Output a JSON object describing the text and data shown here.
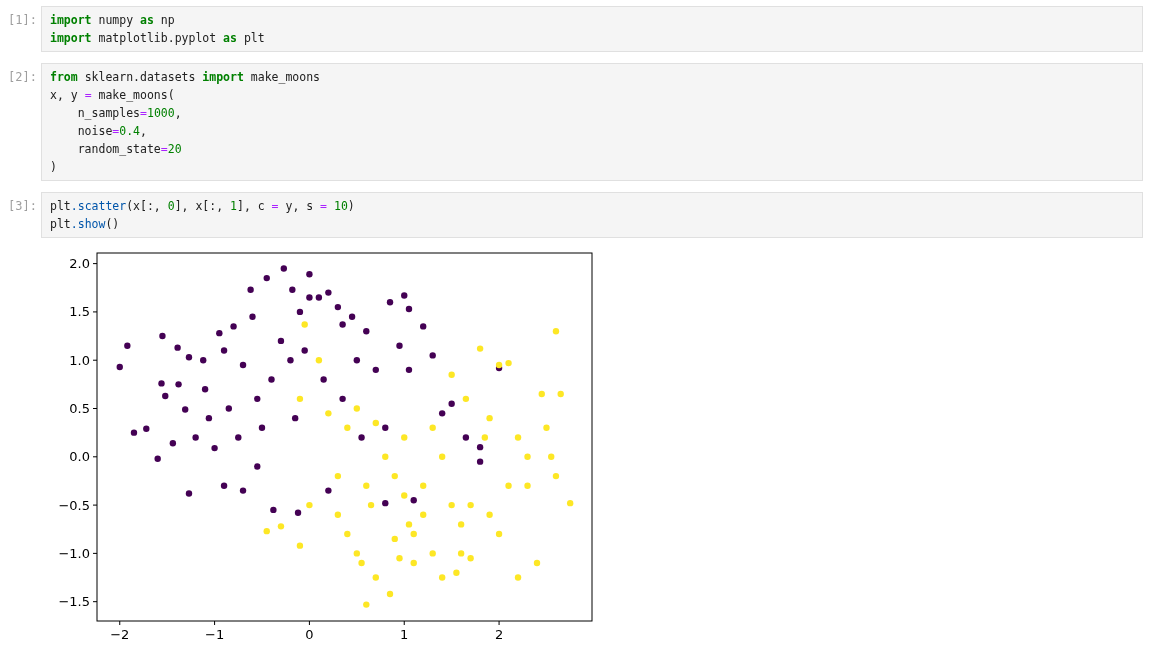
{
  "cells": [
    {
      "prompt": "[1]:",
      "lines": [
        [
          {
            "text": "import",
            "kind": "kw"
          },
          {
            "text": " numpy ",
            "kind": "plain"
          },
          {
            "text": "as",
            "kind": "kw"
          },
          {
            "text": " np",
            "kind": "plain"
          }
        ],
        [
          {
            "text": "import",
            "kind": "kw"
          },
          {
            "text": " matplotlib.pyplot ",
            "kind": "plain"
          },
          {
            "text": "as",
            "kind": "kw"
          },
          {
            "text": " plt",
            "kind": "plain"
          }
        ]
      ]
    },
    {
      "prompt": "[2]:",
      "lines": [
        [
          {
            "text": "from",
            "kind": "kw"
          },
          {
            "text": " sklearn.datasets ",
            "kind": "plain"
          },
          {
            "text": "import",
            "kind": "kw"
          },
          {
            "text": " make_moons",
            "kind": "plain"
          }
        ],
        [
          {
            "text": "x, y ",
            "kind": "plain"
          },
          {
            "text": "=",
            "kind": "op"
          },
          {
            "text": " make_moons(",
            "kind": "plain"
          }
        ],
        [
          {
            "text": "    n_samples",
            "kind": "plain"
          },
          {
            "text": "=",
            "kind": "op"
          },
          {
            "text": "1000",
            "kind": "num"
          },
          {
            "text": ",",
            "kind": "plain"
          }
        ],
        [
          {
            "text": "    noise",
            "kind": "plain"
          },
          {
            "text": "=",
            "kind": "op"
          },
          {
            "text": "0.4",
            "kind": "num"
          },
          {
            "text": ",",
            "kind": "plain"
          }
        ],
        [
          {
            "text": "    random_state",
            "kind": "plain"
          },
          {
            "text": "=",
            "kind": "op"
          },
          {
            "text": "20",
            "kind": "num"
          }
        ],
        [
          {
            "text": ")",
            "kind": "plain"
          }
        ]
      ]
    },
    {
      "prompt": "[3]:",
      "lines": [
        [
          {
            "text": "plt",
            "kind": "plain"
          },
          {
            "text": ".scatter",
            "kind": "prop"
          },
          {
            "text": "(x[:, ",
            "kind": "plain"
          },
          {
            "text": "0",
            "kind": "num"
          },
          {
            "text": "], x[:, ",
            "kind": "plain"
          },
          {
            "text": "1",
            "kind": "num"
          },
          {
            "text": "], c ",
            "kind": "plain"
          },
          {
            "text": "=",
            "kind": "op"
          },
          {
            "text": " y, s ",
            "kind": "plain"
          },
          {
            "text": "=",
            "kind": "op"
          },
          {
            "text": " 10",
            "kind": "num"
          },
          {
            "text": ")",
            "kind": "plain"
          }
        ],
        [
          {
            "text": "plt",
            "kind": "plain"
          },
          {
            "text": ".show",
            "kind": "prop"
          },
          {
            "text": "()",
            "kind": "plain"
          }
        ]
      ],
      "output": {
        "chart_data": {
          "type": "scatter",
          "xlim": [
            -2.24,
            2.98
          ],
          "ylim": [
            -1.7,
            2.11
          ],
          "xticks": [
            {
              "value": -2,
              "label": "−2"
            },
            {
              "value": -1,
              "label": "−1"
            },
            {
              "value": 0,
              "label": "0"
            },
            {
              "value": 1,
              "label": "1"
            },
            {
              "value": 2,
              "label": "2"
            }
          ],
          "yticks": [
            {
              "value": -1.5,
              "label": "−1.5"
            },
            {
              "value": -1,
              "label": "−1.0"
            },
            {
              "value": -0.5,
              "label": "−0.5"
            },
            {
              "value": 0,
              "label": "0.0"
            },
            {
              "value": 0.5,
              "label": "0.5"
            },
            {
              "value": 1,
              "label": "1.0"
            },
            {
              "value": 1.5,
              "label": "1.5"
            },
            {
              "value": 2,
              "label": "2.0"
            }
          ],
          "series": [
            {
              "color": "#440154",
              "x": [
                -2.0,
                -1.92,
                -1.85,
                -1.72,
                -1.6,
                -1.55,
                -1.56,
                -1.52,
                -1.44,
                -1.39,
                -1.38,
                -1.31,
                -1.27,
                -1.27,
                -1.2,
                -1.12,
                -1.1,
                -1.06,
                -1.0,
                -0.95,
                -0.9,
                -0.9,
                -0.85,
                -0.8,
                -0.75,
                -0.7,
                -0.7,
                -0.62,
                -0.6,
                -0.55,
                -0.55,
                -0.45,
                -0.5,
                -0.4,
                -0.38,
                -0.27,
                -0.3,
                -0.2,
                -0.18,
                -0.15,
                -0.1,
                -0.12,
                -0.05,
                0.0,
                0.0,
                0.1,
                0.2,
                0.15,
                0.3,
                0.35,
                0.35,
                0.45,
                0.5,
                0.55,
                0.6,
                0.7,
                0.8,
                0.85,
                0.95,
                1.0,
                1.05,
                1.05,
                1.1,
                1.2,
                1.3,
                1.4,
                1.5,
                1.65,
                1.8,
                2.0,
                0.8,
                1.8,
                0.2
              ],
              "values": [
                0.93,
                1.15,
                0.25,
                0.29,
                -0.02,
                1.25,
                0.76,
                0.63,
                0.14,
                1.13,
                0.75,
                0.49,
                1.03,
                -0.38,
                0.2,
                1.0,
                0.7,
                0.4,
                0.09,
                1.28,
                1.1,
                -0.3,
                0.5,
                1.35,
                0.2,
                0.95,
                -0.35,
                1.73,
                1.45,
                0.6,
                -0.1,
                1.85,
                0.3,
                0.8,
                -0.55,
                1.95,
                1.2,
                1.0,
                1.73,
                0.4,
                1.5,
                -0.58,
                1.1,
                1.89,
                1.65,
                1.65,
                1.7,
                0.8,
                1.55,
                1.37,
                0.6,
                1.45,
                1.0,
                0.2,
                1.3,
                0.9,
                0.3,
                1.6,
                1.15,
                1.67,
                1.53,
                0.9,
                -0.45,
                1.35,
                1.05,
                0.45,
                0.55,
                0.2,
                -0.05,
                0.92,
                -0.48,
                0.1,
                -0.35
              ]
            },
            {
              "color": "#fde725",
              "x": [
                -0.45,
                -0.3,
                -0.1,
                -0.05,
                0.1,
                -0.1,
                0.0,
                0.2,
                0.3,
                0.4,
                0.5,
                0.55,
                0.6,
                0.65,
                0.7,
                0.8,
                0.85,
                0.9,
                0.95,
                1.0,
                1.05,
                1.1,
                1.2,
                1.3,
                1.4,
                1.5,
                1.5,
                1.55,
                1.6,
                1.65,
                1.7,
                1.8,
                1.85,
                1.9,
                2.0,
                2.1,
                2.0,
                2.2,
                2.2,
                2.3,
                2.4,
                2.45,
                2.5,
                2.6,
                2.6,
                2.65,
                2.75,
                2.55,
                1.3,
                1.0,
                0.5,
                0.7,
                1.2,
                1.7,
                2.3,
                0.3,
                0.9,
                1.4,
                1.9,
                2.1,
                0.6,
                1.1,
                1.6,
                0.4
              ],
              "values": [
                -0.77,
                -0.72,
                -0.92,
                1.37,
                1.0,
                0.6,
                -0.5,
                0.45,
                -0.2,
                -0.8,
                -1.0,
                -1.1,
                -1.53,
                -0.5,
                -1.25,
                0.0,
                -1.42,
                -0.85,
                -1.05,
                -0.4,
                -0.7,
                -1.1,
                -0.3,
                -1.0,
                -1.25,
                -0.5,
                0.85,
                -1.2,
                -1.0,
                0.6,
                -1.05,
                1.12,
                0.2,
                -0.6,
                0.95,
                0.97,
                -0.8,
                -1.25,
                0.2,
                -0.3,
                -1.1,
                0.65,
                0.3,
                1.3,
                -0.2,
                0.65,
                -0.48,
                0.0,
                0.3,
                0.2,
                0.5,
                0.35,
                -0.6,
                -0.5,
                0.0,
                -0.6,
                -0.2,
                0.0,
                0.4,
                -0.3,
                -0.3,
                -0.8,
                -0.7,
                0.3
              ]
            }
          ]
        }
      }
    }
  ]
}
